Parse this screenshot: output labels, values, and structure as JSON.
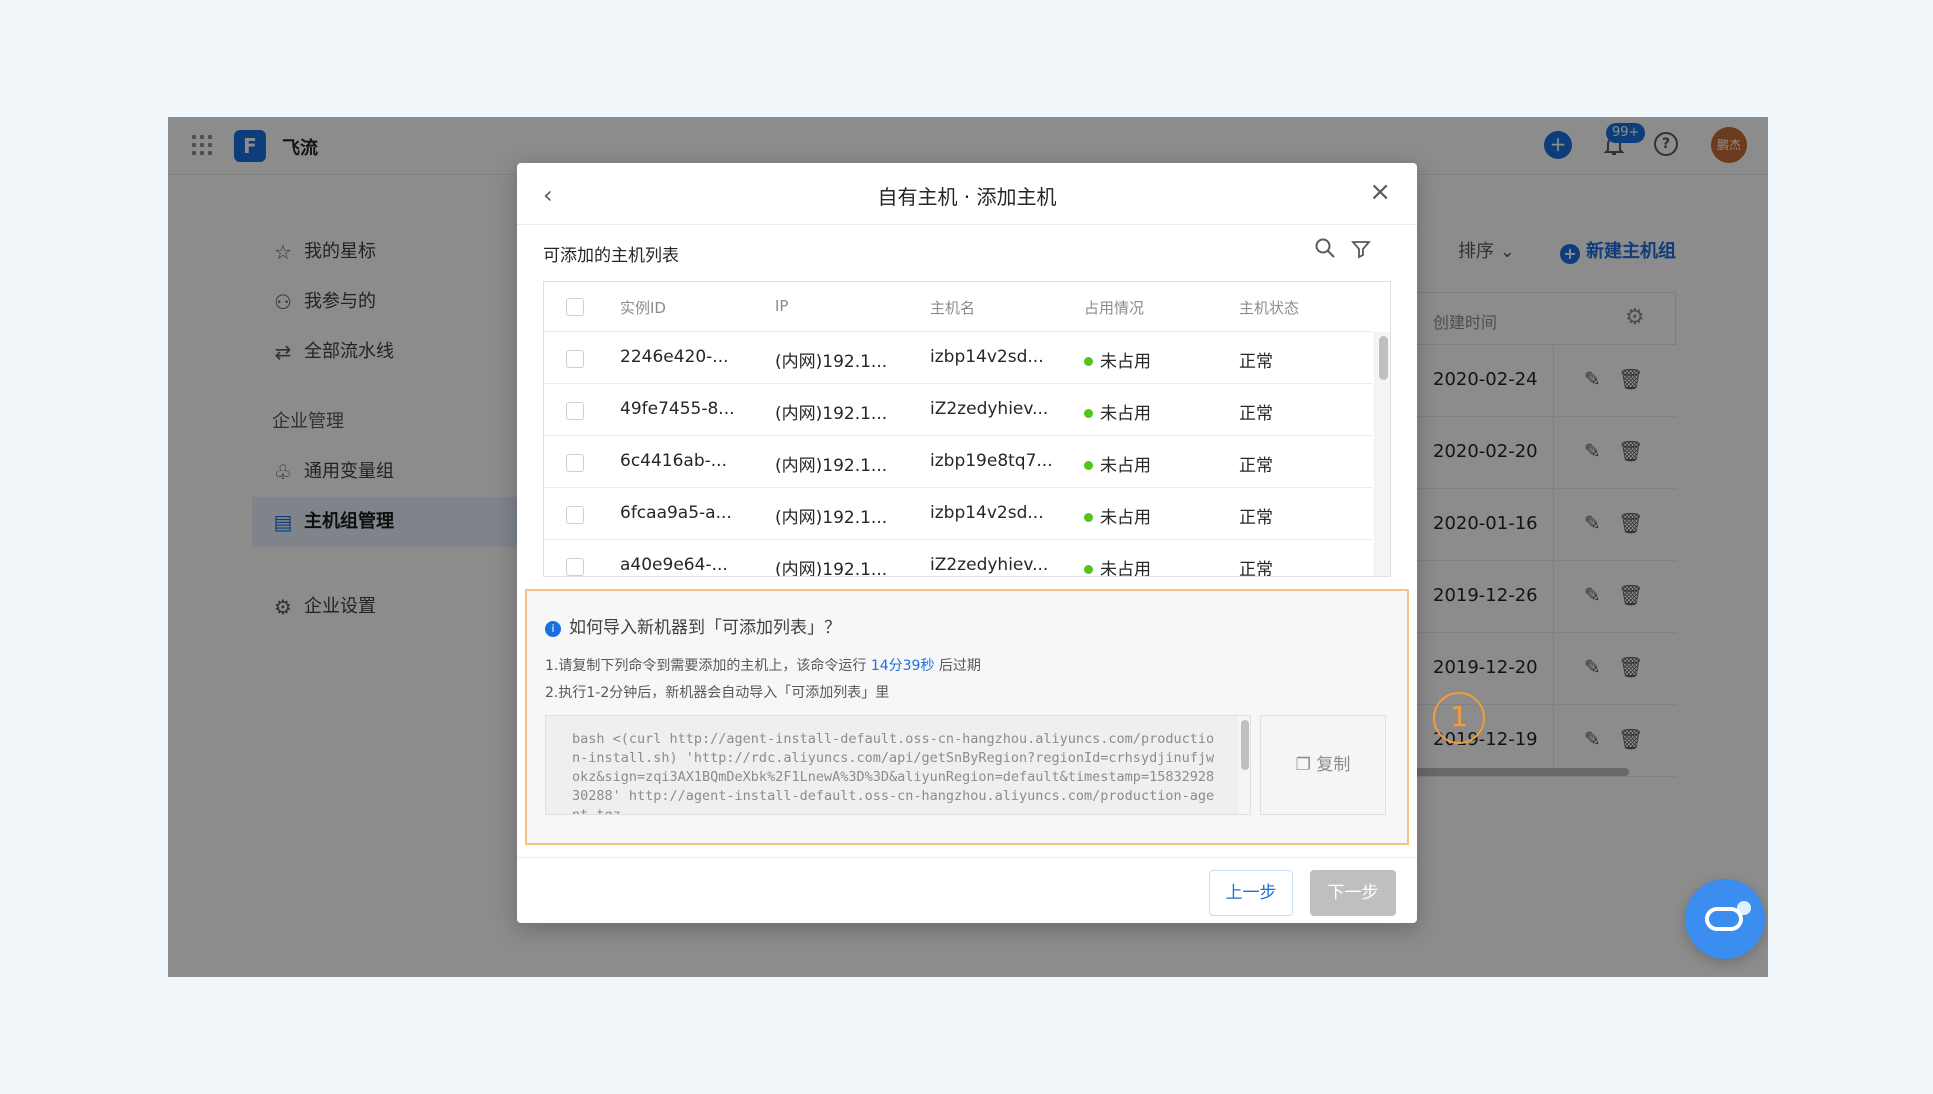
{
  "app": {
    "name": "飞流",
    "logo_letter": "F",
    "badge": "99+",
    "avatar": "鹏杰"
  },
  "sidebar": {
    "items_top": [
      {
        "label": "我的星标",
        "icon": "star-icon"
      },
      {
        "label": "我参与的",
        "icon": "user-group-icon"
      },
      {
        "label": "全部流水线",
        "icon": "pipeline-icon"
      }
    ],
    "group_label": "企业管理",
    "items_group": [
      {
        "label": "通用变量组",
        "icon": "variable-icon"
      },
      {
        "label": "主机组管理",
        "icon": "host-group-icon",
        "active": true
      }
    ],
    "settings": {
      "label": "企业设置",
      "icon": "gear-icon"
    }
  },
  "main": {
    "sort_label": "排序",
    "new_group_label": "新建主机组",
    "column_created": "创建时间",
    "rows": [
      "2020-02-24",
      "2020-02-20",
      "2020-01-16",
      "2019-12-26",
      "2019-12-20",
      "2019-12-19"
    ]
  },
  "annotation": {
    "step": "1"
  },
  "modal": {
    "title": "自有主机 · 添加主机",
    "subtitle": "可添加的主机列表",
    "columns": [
      "实例ID",
      "IP",
      "主机名",
      "占用情况",
      "主机状态"
    ],
    "rows": [
      {
        "id": "2246e420-...",
        "ip": "(内网)192.1...",
        "host": "izbp14v2sd...",
        "usage": "未占用",
        "status": "正常"
      },
      {
        "id": "49fe7455-8...",
        "ip": "(内网)192.1...",
        "host": "iZ2zedyhiev...",
        "usage": "未占用",
        "status": "正常"
      },
      {
        "id": "6c4416ab-...",
        "ip": "(内网)192.1...",
        "host": "izbp19e8tq7...",
        "usage": "未占用",
        "status": "正常"
      },
      {
        "id": "6fcaa9a5-a...",
        "ip": "(内网)192.1...",
        "host": "izbp14v2sd...",
        "usage": "未占用",
        "status": "正常"
      },
      {
        "id": "a40e9e64-...",
        "ip": "(内网)192.1...",
        "host": "iZ2zedyhiev...",
        "usage": "未占用",
        "status": "正常"
      }
    ],
    "tips": {
      "title": "如何导入新机器到「可添加列表」？",
      "line1_prefix": "1.请复制下列命令到需要添加的主机上，该命令运行",
      "countdown": "14分39秒",
      "line1_suffix": "后过期",
      "line2": "2.执行1-2分钟后，新机器会自动导入「可添加列表」里",
      "command": "bash <(curl http://agent-install-default.oss-cn-hangzhou.aliyuncs.com/production-install.sh) 'http://rdc.aliyuncs.com/api/getSnByRegion?regionId=crhsydjinufjwokz&sign=zqi3AX1BQmDeXbk%2F1LnewA%3D%3D&aliyunRegion=default&timestamp=1583292830288' http://agent-install-default.oss-cn-hangzhou.aliyuncs.com/production-agent.tgz",
      "copy_label": "复制"
    },
    "prev_label": "上一步",
    "next_label": "下一步"
  }
}
